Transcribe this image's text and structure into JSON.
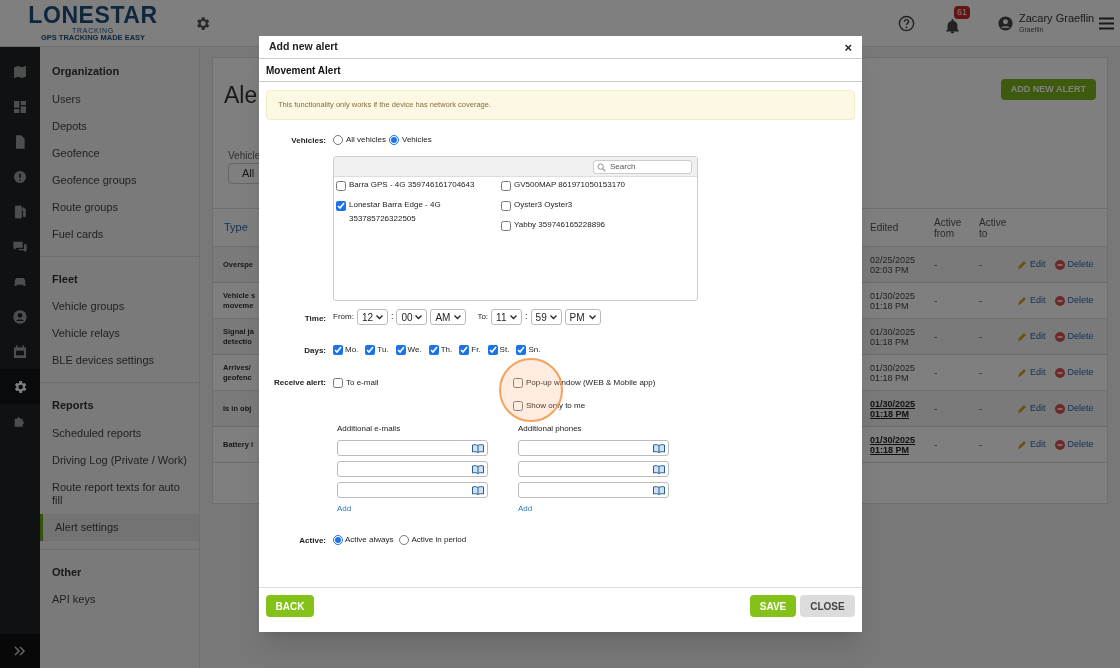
{
  "header": {
    "logo": {
      "name": "LONESTAR",
      "sub": "TRACKING",
      "tagline": "GPS TRACKING MADE EASY"
    },
    "notifications": "61",
    "user": {
      "name": "Zacary Graeflin",
      "org": "Graeflin"
    }
  },
  "rail": [
    {
      "kind": "map",
      "selected": false
    },
    {
      "kind": "dashboard",
      "selected": false
    },
    {
      "kind": "document",
      "selected": false
    },
    {
      "kind": "alert",
      "selected": false
    },
    {
      "kind": "fuel",
      "selected": false
    },
    {
      "kind": "chat",
      "selected": false
    },
    {
      "kind": "car",
      "selected": false
    },
    {
      "kind": "user",
      "selected": false
    },
    {
      "kind": "calendar",
      "selected": false
    },
    {
      "kind": "gear",
      "selected": true
    },
    {
      "kind": "puzzle",
      "selected": false
    }
  ],
  "sidebar": {
    "sections": [
      {
        "title": "Organization",
        "items": [
          {
            "label": "Users",
            "selected": false
          },
          {
            "label": "Depots",
            "selected": false
          },
          {
            "label": "Geofence",
            "selected": false
          },
          {
            "label": "Geofence groups",
            "selected": false
          },
          {
            "label": "Route groups",
            "selected": false
          },
          {
            "label": "Fuel cards",
            "selected": false
          }
        ]
      },
      {
        "title": "Fleet",
        "items": [
          {
            "label": "Vehicle groups",
            "selected": false
          },
          {
            "label": "Vehicle relays",
            "selected": false
          },
          {
            "label": "BLE devices settings",
            "selected": false
          }
        ]
      },
      {
        "title": "Reports",
        "items": [
          {
            "label": "Scheduled reports",
            "selected": false
          },
          {
            "label": "Driving Log (Private / Work)",
            "selected": false
          },
          {
            "label": "Route report texts for auto fill",
            "selected": false
          },
          {
            "label": "Alert settings",
            "selected": true
          }
        ]
      },
      {
        "title": "Other",
        "items": [
          {
            "label": "API keys",
            "selected": false
          }
        ]
      }
    ]
  },
  "page": {
    "title": "Ale",
    "add_button": "ADD NEW ALERT",
    "filter": {
      "label": "Vehicle",
      "value": "All"
    },
    "table": {
      "columns": {
        "type": "Type",
        "edited": "Edited",
        "active_from": "Active from",
        "active_to": "Active to"
      },
      "rows": [
        {
          "type": [
            "Overspe"
          ],
          "edited": "02/25/2025 02:03 PM",
          "emphasized": false,
          "active_from": "-",
          "active_to": "-",
          "edit": "Edit",
          "delete": "Delete"
        },
        {
          "type": [
            "Vehicle s",
            "moveme"
          ],
          "edited": "01/30/2025 01:18 PM",
          "emphasized": false,
          "active_from": "-",
          "active_to": "-",
          "edit": "Edit",
          "delete": "Delete"
        },
        {
          "type": [
            "Signal ja",
            "detectio"
          ],
          "edited": "01/30/2025 01:18 PM",
          "emphasized": false,
          "active_from": "-",
          "active_to": "-",
          "edit": "Edit",
          "delete": "Delete"
        },
        {
          "type": [
            "Arrives/",
            "geofenc"
          ],
          "edited": "01/30/2025 01:18 PM",
          "emphasized": false,
          "active_from": "-",
          "active_to": "-",
          "edit": "Edit",
          "delete": "Delete"
        },
        {
          "type": [
            "Is in obj"
          ],
          "edited": "01/30/2025 01:18 PM",
          "emphasized": true,
          "active_from": "-",
          "active_to": "-",
          "edit": "Edit",
          "delete": "Delete"
        },
        {
          "type": [
            "Battery l"
          ],
          "edited": "01/30/2025 01:18 PM",
          "emphasized": true,
          "active_from": "-",
          "active_to": "-",
          "edit": "Edit",
          "delete": "Delete"
        }
      ]
    }
  },
  "modal": {
    "title": "Add new alert",
    "close": "×",
    "section": "Movement Alert",
    "notice": "This functionality only works if the device has network coverage.",
    "vehicles": {
      "label": "Vehicles:",
      "options": [
        {
          "label": "All vehicles",
          "selected": false
        },
        {
          "label": "Vehicles",
          "selected": true
        }
      ],
      "search": {
        "placeholder": "Search"
      },
      "columns": [
        [
          {
            "label": "Barra GPS - 4G 359746161704643",
            "checked": false
          },
          {
            "label": "Lonestar Barra Edge - 4G 353785726322505",
            "checked": true
          }
        ],
        [
          {
            "label": "GV500MAP 861971050153170",
            "checked": false
          },
          {
            "label": "Oyster3 Oyster3",
            "checked": false
          },
          {
            "label": "Yabby 359746165228896",
            "checked": false
          }
        ]
      ]
    },
    "time": {
      "label": "Time:",
      "from_label": "From:",
      "from": {
        "hour": "12",
        "minute": "00",
        "period": "AM"
      },
      "to_label": "To:",
      "to": {
        "hour": "11",
        "minute": "59",
        "period": "PM"
      },
      "separator": ":"
    },
    "days": {
      "label": "Days:",
      "items": [
        {
          "label": "Mo.",
          "checked": true
        },
        {
          "label": "Tu.",
          "checked": true
        },
        {
          "label": "We.",
          "checked": true
        },
        {
          "label": "Th.",
          "checked": true
        },
        {
          "label": "Fr.",
          "checked": true
        },
        {
          "label": "St.",
          "checked": true
        },
        {
          "label": "Sn.",
          "checked": true
        }
      ]
    },
    "receive": {
      "label": "Receive alert:",
      "email": {
        "label": "To e-mail",
        "checked": false
      },
      "popup": {
        "label": "Pop-up window (WEB & Mobile app)",
        "checked": false
      },
      "only_me": {
        "label": "Show only to me",
        "checked": false
      }
    },
    "emails": {
      "label": "Additional e-mails",
      "fields": [
        {
          "kind": "input"
        },
        {
          "kind": "input"
        },
        {
          "kind": "input"
        }
      ],
      "add": "Add"
    },
    "phones": {
      "label": "Additional phones",
      "fields": [
        {
          "kind": "input"
        },
        {
          "kind": "input"
        },
        {
          "kind": "input"
        }
      ],
      "add": "Add"
    },
    "active": {
      "label": "Active:",
      "options": [
        {
          "label": "Active always",
          "selected": true
        },
        {
          "label": "Active in period",
          "selected": false
        }
      ]
    },
    "buttons": {
      "back": "BACK",
      "save": "SAVE",
      "close": "CLOSE"
    }
  }
}
